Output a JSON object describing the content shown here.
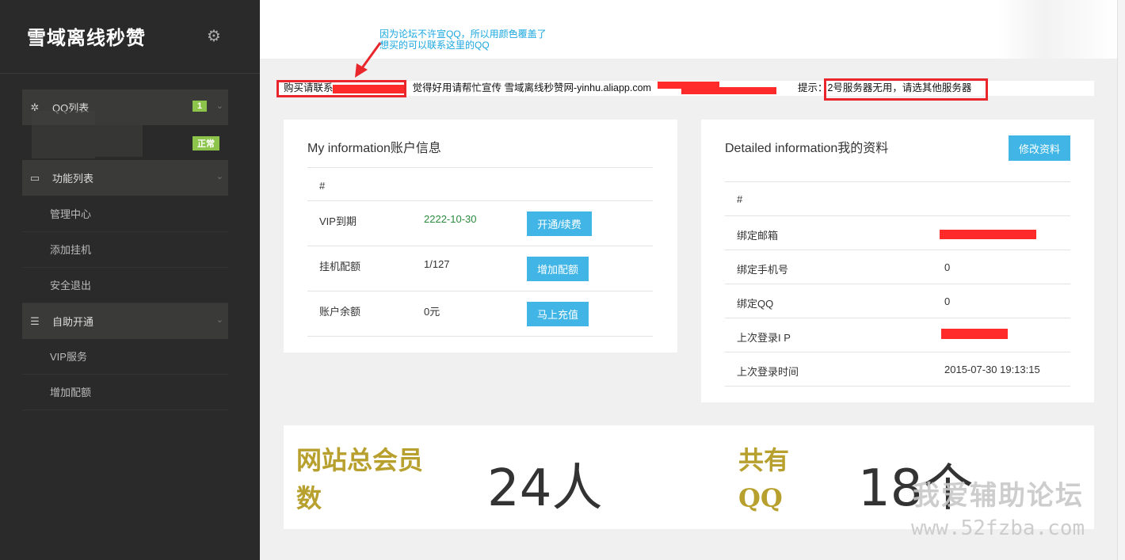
{
  "sidebar": {
    "brand": "雪域离线秒赞",
    "brand_icon": "gear-icon",
    "groups": [
      {
        "label": "QQ列表",
        "icon": "snowflake-icon",
        "badge": "1"
      },
      {
        "label": "功能列表",
        "icon": "monitor-icon"
      },
      {
        "label": "自助开通",
        "icon": "database-icon"
      }
    ],
    "qq_status_badge": "正常",
    "function_items": [
      "管理中心",
      "添加挂机",
      "安全退出"
    ],
    "self_service_items": [
      "VIP服务",
      "增加配额"
    ]
  },
  "annotation": {
    "line1": "因为论坛不许宣QQ，所以用颜色覆盖了",
    "line2": "想买的可以联系这里的QQ"
  },
  "marquee": {
    "part1": "购买请联系",
    "part2": "觉得好用请帮忙宣传 雪域离线秒赞网-yinhu.aliapp.com",
    "part3": "提示：",
    "part4": "2号服务器无用，请选其他服务器"
  },
  "account_card": {
    "title": "My information账户信息",
    "header": "#",
    "rows": [
      {
        "label": "VIP到期",
        "value": "2222-10-30",
        "button": "开通/续费"
      },
      {
        "label": "挂机配额",
        "value": "1/127",
        "button": "增加配额"
      },
      {
        "label": "账户余额",
        "value": "0元",
        "button": "马上充值"
      }
    ]
  },
  "profile_card": {
    "title": "Detailed information我的资料",
    "edit_button": "修改资料",
    "header": "#",
    "rows": [
      {
        "label": "绑定邮箱",
        "value": ""
      },
      {
        "label": "绑定手机号",
        "value": "0"
      },
      {
        "label": "绑定QQ",
        "value": "0"
      },
      {
        "label": "上次登录I P",
        "value": ""
      },
      {
        "label": "上次登录时间",
        "value": "2015-07-30 19:13:15"
      }
    ]
  },
  "stats": {
    "members_label_1": "网站总会员",
    "members_label_2": "数",
    "members_value": "24人",
    "qq_label_1": "共有",
    "qq_label_2": "QQ",
    "qq_value": "18个"
  },
  "watermark": {
    "line1": "我爱辅助论坛",
    "line2": "www.52fzba.com"
  },
  "colors": {
    "sidebar_bg": "#2a2a2a",
    "accent_blue": "#41b6e6",
    "badge_green": "#8cc34a",
    "highlight_red": "#e8262b",
    "gold": "#b8a02e"
  }
}
